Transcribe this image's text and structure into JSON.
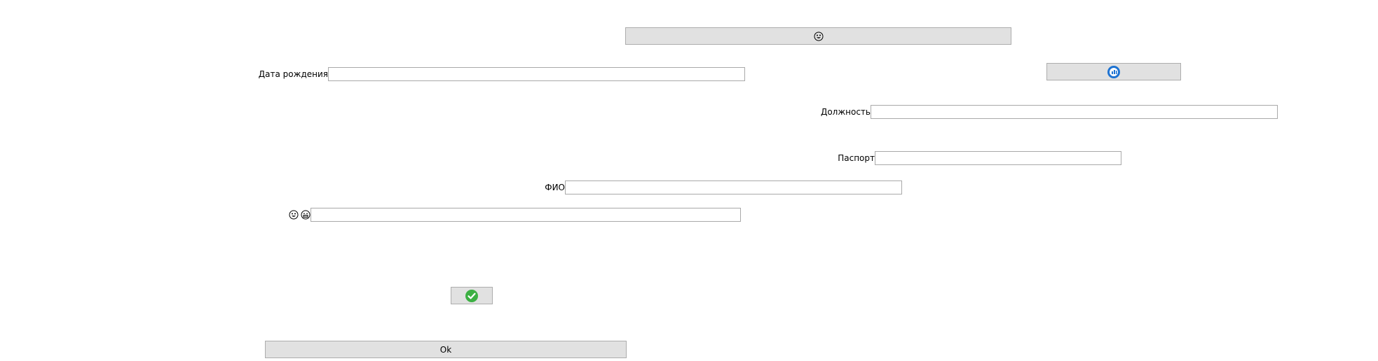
{
  "form": {
    "top_button": {
      "icon": "smile-face-icon"
    },
    "birth_date": {
      "label": "Дата рождения",
      "value": "",
      "placeholder": ""
    },
    "refresh_button": {
      "icon": "blue-round-app-icon"
    },
    "position_field": {
      "label": "Должность",
      "value": "",
      "placeholder": ""
    },
    "passport_field": {
      "label": "Паспорт",
      "value": "",
      "placeholder": ""
    },
    "fio_field": {
      "label": "ФИО",
      "value": "",
      "placeholder": ""
    },
    "emoji_field": {
      "icons": [
        "smile-face-icon",
        "grin-face-icon"
      ],
      "value": "",
      "placeholder": ""
    },
    "check_button": {
      "icon": "green-check-icon",
      "color": "#3cb043"
    },
    "ok_button": {
      "label": "Ok"
    }
  },
  "colors": {
    "button_bg": "#e1e1e1",
    "button_border": "#adadad",
    "field_border": "#a9a9a9",
    "accent_blue": "#1e73d2",
    "accent_green": "#3cb043"
  }
}
